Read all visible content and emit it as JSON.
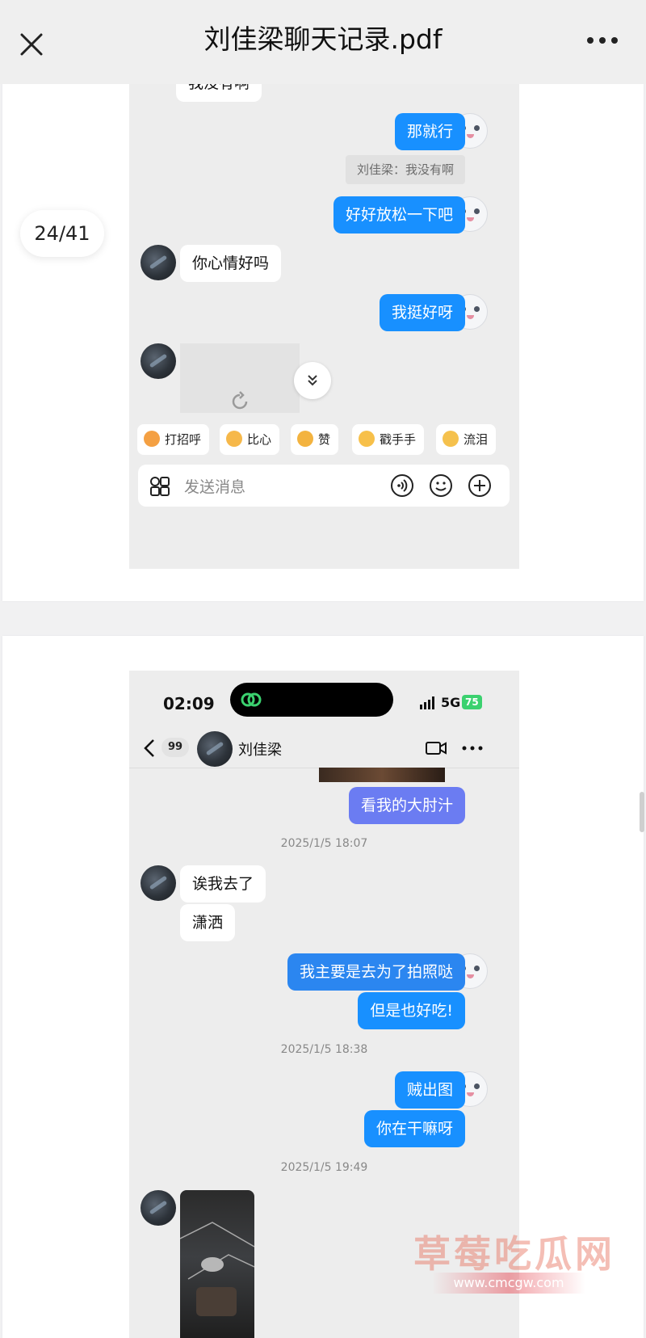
{
  "header": {
    "title": "刘佳梁聊天记录.pdf",
    "close_icon": "close-icon",
    "more_icon": "more-dots-icon"
  },
  "page_indicator": "24/41",
  "page1": {
    "partial_top_text": "我没有啊",
    "messages": [
      {
        "side": "out",
        "text": "那就行"
      },
      {
        "quote": "刘佳梁：我没有啊"
      },
      {
        "side": "out",
        "text": "好好放松一下吧"
      },
      {
        "side": "in",
        "text": "你心情好吗"
      },
      {
        "side": "out",
        "text": "我挺好呀"
      },
      {
        "side": "in",
        "type": "image-loading"
      }
    ],
    "quick_replies": [
      "打招呼",
      "比心",
      "赞",
      "戳手手",
      "流泪"
    ],
    "input_placeholder": "发送消息"
  },
  "page2": {
    "status": {
      "time": "02:09",
      "network": "5G",
      "battery": "75"
    },
    "chat_header": {
      "unread": "99",
      "name": "刘佳梁"
    },
    "messages": [
      {
        "side": "out",
        "text": "看我的大肘汁"
      },
      {
        "timestamp": "2025/1/5 18:07"
      },
      {
        "side": "in",
        "text": "诶我去了"
      },
      {
        "side": "in",
        "text": "潇洒"
      },
      {
        "side": "out",
        "text": "我主要是去为了拍照哒"
      },
      {
        "side": "out",
        "text": "但是也好吃!"
      },
      {
        "timestamp": "2025/1/5 18:38"
      },
      {
        "side": "out",
        "text": "贼出图"
      },
      {
        "side": "out",
        "text": "你在干嘛呀"
      },
      {
        "timestamp": "2025/1/5 19:49"
      }
    ]
  },
  "watermark": {
    "title": "草莓吃瓜网",
    "url": "www.cmcgw.com"
  },
  "colors": {
    "out_bubble": "#1890ff",
    "purple_bubble": "#6b7cf2",
    "chat_bg": "#ededed"
  }
}
